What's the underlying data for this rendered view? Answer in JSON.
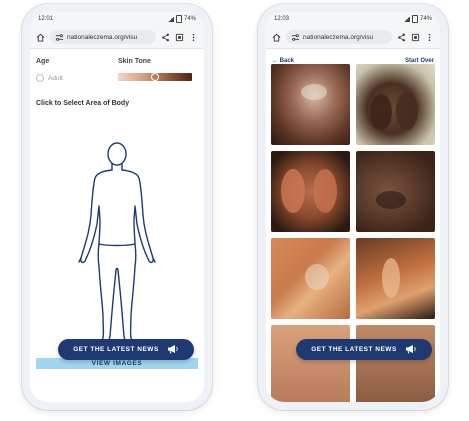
{
  "phones": [
    {
      "status": {
        "time": "12:01",
        "battery": "74%"
      },
      "browser": {
        "url": "nationaleczema.org/visu"
      },
      "form": {
        "age_label": "Age",
        "age_value": "Adult",
        "skin_tone_label": "Skin Tone",
        "skin_tone_level": 0.5,
        "select_area_label": "Click to Select Area of Body"
      },
      "view_images_label": "VIEW IMAGES",
      "news_label": "GET THE LATEST NEWS"
    },
    {
      "status": {
        "time": "12:03",
        "battery": "74%"
      },
      "browser": {
        "url": "nationaleczema.org/visu"
      },
      "nav": {
        "back_label": "← Back",
        "start_over_label": "Start Over"
      },
      "news_label": "GET THE LATEST NEWS"
    }
  ],
  "colors": {
    "brand_navy": "#1f3a70",
    "view_images_bg": "#9fd6ee",
    "body_outline": "#1f3a70"
  }
}
